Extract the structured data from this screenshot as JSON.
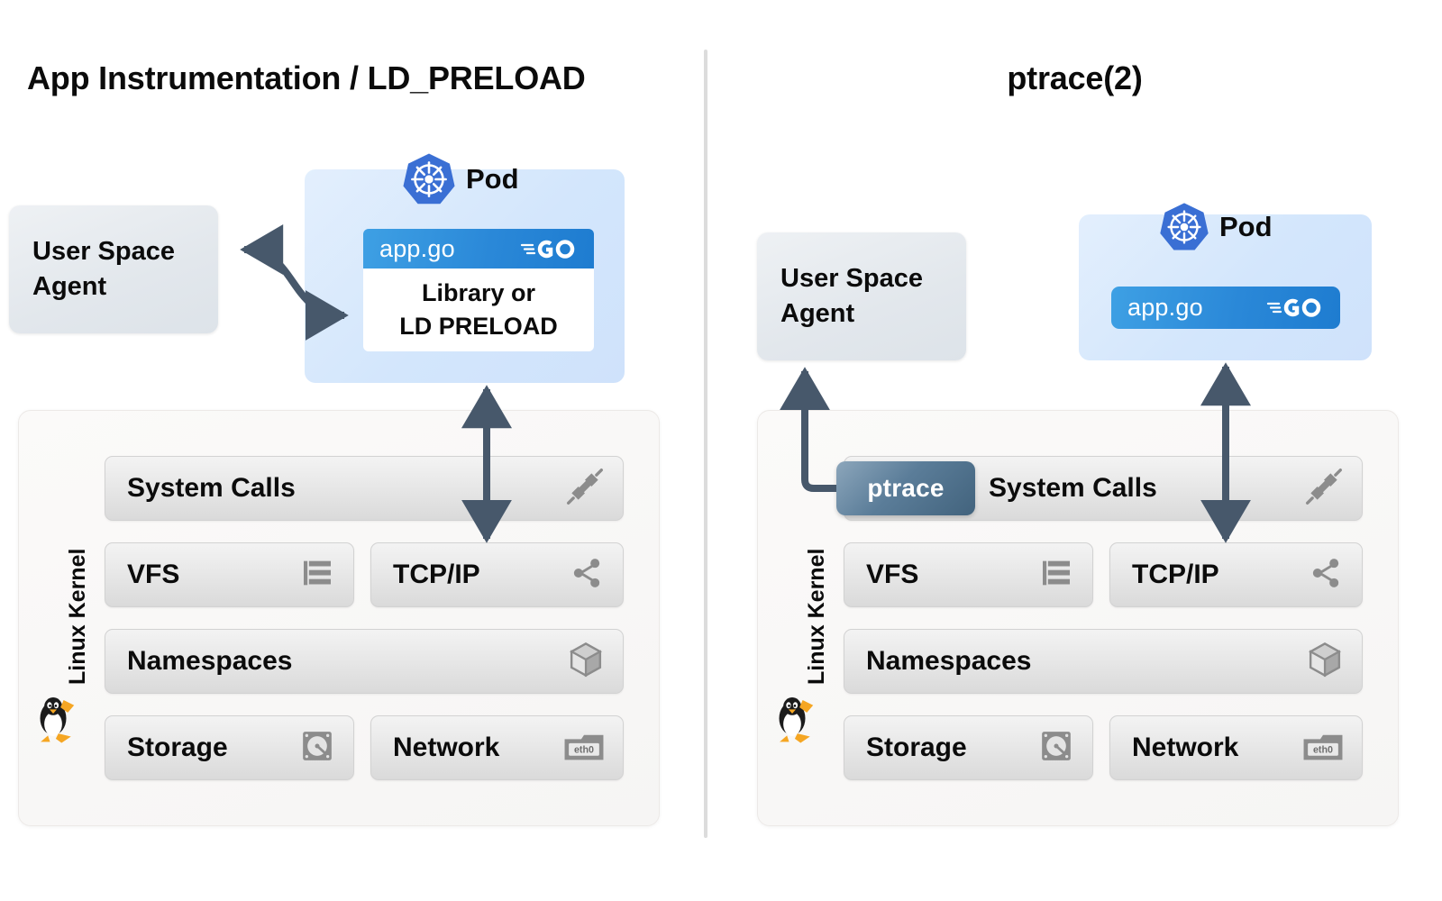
{
  "diagram": {
    "title_hidden": "Comparison of tracing approaches",
    "divider": "vertical-divider"
  },
  "colors": {
    "arrow": "#47586b",
    "kubernetes_blue": "#3a6fd4",
    "go_blue": "#2a88d8",
    "ptrace_badge": "#5b7d99",
    "pod_background": "#d3e6fc",
    "kernel_row": "#e8e8e8",
    "kernel_panel": "#f6f5f4",
    "agent_box": "#e2e7ec",
    "divider": "#dcdcdc",
    "tux_yellow": "#f5a623"
  },
  "left_panel": {
    "title": "App Instrumentation / LD_PRELOAD",
    "agent": {
      "label": "User Space\nAgent",
      "name": "user-space-agent"
    },
    "pod": {
      "title": "Pod",
      "logo": "kubernetes-icon",
      "app": {
        "name": "app.go",
        "logo": "go-icon"
      },
      "library": {
        "label": "Library or\nLD PRELOAD"
      }
    },
    "kernel": {
      "vertical_label": "Linux Kernel",
      "mascot": "tux-penguin-icon",
      "rows": [
        {
          "label": "System Calls",
          "icon": "plug-icon",
          "span": "full"
        },
        {
          "label": "VFS",
          "icon": "layers-list-icon",
          "span": "half-left"
        },
        {
          "label": "TCP/IP",
          "icon": "share-network-icon",
          "span": "half-right"
        },
        {
          "label": "Namespaces",
          "icon": "cube-icon",
          "span": "full"
        },
        {
          "label": "Storage",
          "icon": "hard-disk-icon",
          "span": "half-left"
        },
        {
          "label": "Network",
          "icon": "eth0-nic-icon",
          "span": "half-right"
        }
      ]
    },
    "connectors": [
      {
        "name": "agent-to-library-arrow",
        "style": "double-headed-s-curve"
      },
      {
        "name": "pod-to-tcpip-arrow",
        "style": "double-headed-vertical"
      }
    ]
  },
  "right_panel": {
    "title": "ptrace(2)",
    "agent": {
      "label": "User Space\nAgent",
      "name": "user-space-agent"
    },
    "pod": {
      "title": "Pod",
      "logo": "kubernetes-icon",
      "app": {
        "name": "app.go",
        "logo": "go-icon"
      }
    },
    "ptrace_badge": {
      "label": "ptrace"
    },
    "kernel": {
      "vertical_label": "Linux Kernel",
      "mascot": "tux-penguin-icon",
      "rows": [
        {
          "label": "System Calls",
          "icon": "plug-icon",
          "span": "full"
        },
        {
          "label": "VFS",
          "icon": "layers-list-icon",
          "span": "half-left"
        },
        {
          "label": "TCP/IP",
          "icon": "share-network-icon",
          "span": "half-right"
        },
        {
          "label": "Namespaces",
          "icon": "cube-icon",
          "span": "full"
        },
        {
          "label": "Storage",
          "icon": "hard-disk-icon",
          "span": "half-left"
        },
        {
          "label": "Network",
          "icon": "eth0-nic-icon",
          "span": "half-right"
        }
      ]
    },
    "connectors": [
      {
        "name": "ptrace-to-agent-arrow",
        "style": "elbow-up"
      },
      {
        "name": "pod-to-tcpip-arrow",
        "style": "double-headed-vertical"
      }
    ]
  }
}
